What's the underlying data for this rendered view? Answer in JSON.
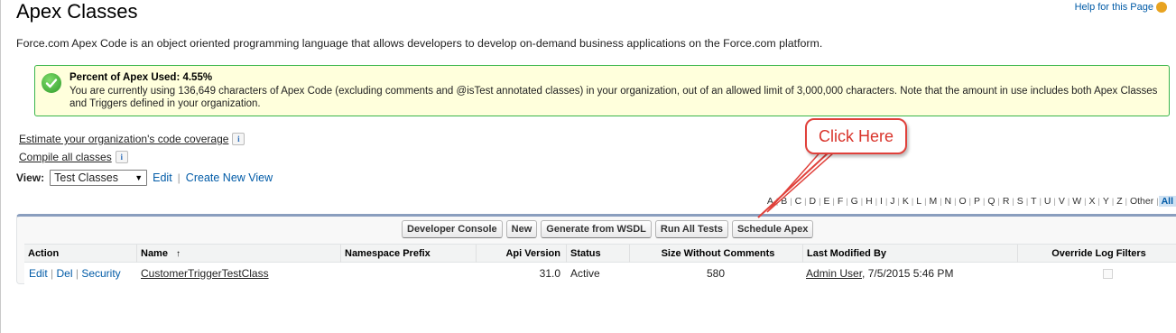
{
  "page": {
    "title": "Apex Classes",
    "help_link": "Help for this Page",
    "description": "Force.com Apex Code is an object oriented programming language that allows developers to develop on-demand business applications on the Force.com platform."
  },
  "message": {
    "title": "Percent of Apex Used: 4.55%",
    "body": "You are currently using 136,649 characters of Apex Code (excluding comments and @isTest annotated classes) in your organization, out of an allowed limit of 3,000,000 characters. Note that the amount in use includes both Apex Classes and Triggers defined in your organization.",
    "icon": "check-icon",
    "border_color": "#39b54a"
  },
  "links": {
    "estimate": "Estimate your organization's code coverage",
    "compile": "Compile all classes"
  },
  "view": {
    "label": "View:",
    "selected": "Test Classes",
    "edit": "Edit",
    "separator": "|",
    "create": "Create New View"
  },
  "alphabet": [
    "A",
    "B",
    "C",
    "D",
    "E",
    "F",
    "G",
    "H",
    "I",
    "J",
    "K",
    "L",
    "M",
    "N",
    "O",
    "P",
    "Q",
    "R",
    "S",
    "T",
    "U",
    "V",
    "W",
    "X",
    "Y",
    "Z",
    "Other",
    "All"
  ],
  "toolbar": {
    "developer_console": "Developer Console",
    "new": "New",
    "generate_wsdl": "Generate from WSDL",
    "run_all_tests": "Run All Tests",
    "schedule_apex": "Schedule Apex"
  },
  "table": {
    "columns": {
      "action": "Action",
      "name": "Name",
      "sort_indicator": "↑",
      "namespace": "Namespace Prefix",
      "api_version": "Api Version",
      "status": "Status",
      "size": "Size Without Comments",
      "last_modified": "Last Modified By",
      "override": "Override Log Filters"
    },
    "rows": [
      {
        "edit": "Edit",
        "del": "Del",
        "security": "Security",
        "name": "CustomerTriggerTestClass",
        "namespace": "",
        "api_version": "31.0",
        "status": "Active",
        "size": "580",
        "modified_user": "Admin User",
        "modified_date": ", 7/5/2015 5:46 PM",
        "override": false
      }
    ]
  },
  "annotation": {
    "callout": "Click Here",
    "color": "#e0413b"
  }
}
